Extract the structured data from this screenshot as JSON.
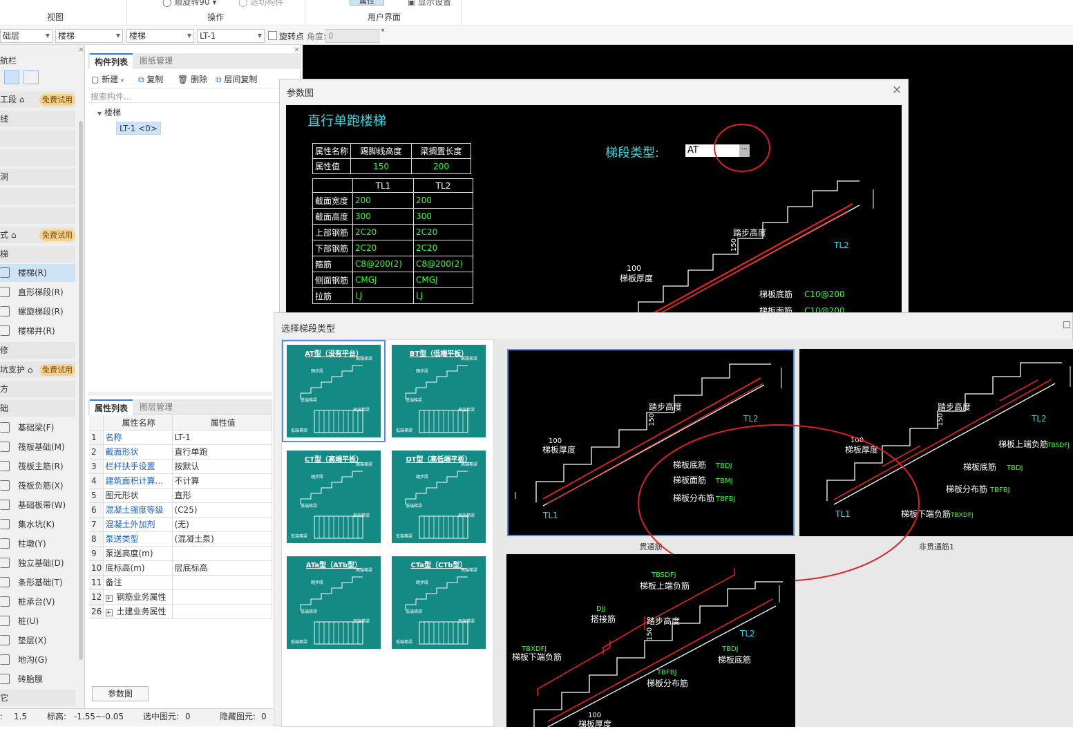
{
  "ribbon": {
    "groups": [
      "视图",
      "操作",
      "用户界面"
    ],
    "rotate_label": "顺旋转90",
    "assign_label": "选切构件",
    "property_btn": "属性",
    "display_label": "显示设置"
  },
  "toolbar": {
    "floor": "础层",
    "category": "楼梯",
    "type": "楼梯",
    "component": "LT-1",
    "rotate_point": "旋转点",
    "angle_label": "角度:",
    "angle_value": "0",
    "degree": "°"
  },
  "nav": {
    "title": "航栏",
    "rows": [
      {
        "label": "工段",
        "badge": "免费试用"
      },
      {
        "label": "线"
      },
      {
        "label": ""
      },
      {
        "label": ""
      },
      {
        "label": "洞"
      },
      {
        "label": ""
      },
      {
        "label": ""
      },
      {
        "label": "式",
        "badge": "免费试用"
      },
      {
        "label": "梯"
      }
    ],
    "stairs": [
      "楼梯(R)",
      "直形梯段(R)",
      "螺旋梯段(R)",
      "楼梯井(R)"
    ],
    "row_mid": "修",
    "support": {
      "label": "坑支护",
      "badge": "免费试用"
    },
    "row_b": "方",
    "row_c": "础",
    "foundation": [
      "基础梁(F)",
      "筏板基础(M)",
      "筏板主筋(R)",
      "筏板负筋(X)",
      "基础板带(W)",
      "集水坑(K)",
      "柱墩(Y)",
      "独立基础(D)",
      "条形基础(T)",
      "桩承台(V)",
      "桩(U)",
      "垫层(X)",
      "地沟(G)",
      "砖胎膜"
    ],
    "row_last": "它"
  },
  "component_list": {
    "tabs": [
      "构件列表",
      "图纸管理"
    ],
    "actions": [
      "新建",
      "复制",
      "删除",
      "层间复制"
    ],
    "search_placeholder": "搜索构件...",
    "tree_root": "楼梯",
    "tree_item": "LT-1 <0>"
  },
  "property_list": {
    "tabs": [
      "属性列表",
      "图层管理"
    ],
    "headers": [
      "属性名称",
      "属性值"
    ],
    "rows": [
      {
        "no": "1",
        "name": "名称",
        "value": "LT-1",
        "blue": true
      },
      {
        "no": "2",
        "name": "截面形状",
        "value": "直行单跑",
        "blue": true
      },
      {
        "no": "3",
        "name": "栏杆扶手设置",
        "value": "按默认",
        "blue": true
      },
      {
        "no": "4",
        "name": "建筑面积计算...",
        "value": "不计算",
        "blue": true
      },
      {
        "no": "5",
        "name": "图元形状",
        "value": "直形",
        "blue": false
      },
      {
        "no": "6",
        "name": "混凝土强度等级",
        "value": "(C25)",
        "blue": true
      },
      {
        "no": "7",
        "name": "混凝土外加剂",
        "value": "(无)",
        "blue": true
      },
      {
        "no": "8",
        "name": "泵送类型",
        "value": "(混凝土泵)",
        "blue": true
      },
      {
        "no": "9",
        "name": "泵送高度(m)",
        "value": "",
        "blue": false
      },
      {
        "no": "10",
        "name": "底标高(m)",
        "value": "层底标高",
        "blue": false
      },
      {
        "no": "11",
        "name": "备注",
        "value": "",
        "blue": false
      },
      {
        "no": "12",
        "name": "钢筋业务属性",
        "value": "",
        "blue": false,
        "expand": true
      },
      {
        "no": "26",
        "name": "土建业务属性",
        "value": "",
        "blue": false,
        "expand": true
      }
    ],
    "param_button": "参数图"
  },
  "status": {
    "scale": "1.5",
    "elev_label": "标高:",
    "elev_value": "-1.55~-0.05",
    "selected_label": "选中图元:",
    "selected_value": "0",
    "hidden_label": "隐藏图元:",
    "hidden_value": "0"
  },
  "param_dialog": {
    "title": "参数图",
    "heading": "直行单跑楼梯",
    "segment_label": "梯段类型:",
    "segment_value": "AT",
    "t1_headers": [
      "属性名称",
      "踢脚线高度",
      "梁搁置长度"
    ],
    "t1_row": [
      "属性值",
      "150",
      "200"
    ],
    "t2_headers": [
      "",
      "TL1",
      "TL2"
    ],
    "t2_rows": [
      [
        "截面宽度",
        "200",
        "200"
      ],
      [
        "截面高度",
        "300",
        "300"
      ],
      [
        "上部钢筋",
        "2C20",
        "2C20"
      ],
      [
        "下部钢筋",
        "2C20",
        "2C20"
      ],
      [
        "箍筋",
        "C8@200(2)",
        "C8@200(2)"
      ],
      [
        "侧面钢筋",
        "CMGJ",
        "CMGJ"
      ],
      [
        "拉筋",
        "LJ",
        "LJ"
      ]
    ],
    "drawing": {
      "step_height": "踏步高度",
      "v150": "150",
      "v100": "100",
      "slab_thk": "梯板厚度",
      "tl2": "TL2",
      "bottom_bar": "梯板底筋",
      "bottom_val": "C10@200",
      "face_bar": "梯板面筋",
      "face_val": "C10@200"
    }
  },
  "select_dialog": {
    "title": "选择梯段类型",
    "types": [
      "AT型（没有平台）",
      "BT型（低端平板）",
      "CT型（高端平板）",
      "DT型（高低端平板）",
      "ATa型（ATb型）",
      "CTa型（CTb型）"
    ],
    "thumb_labels": [
      "踏步段",
      "低端梯梁",
      "高端梯梁",
      "低端平板",
      "高端平板",
      "滑动支座"
    ],
    "captions": [
      "贯通筋",
      "非贯通筋1"
    ],
    "p1": {
      "step": "踏步高度",
      "v150": "150",
      "v100": "100",
      "thk": "梯板厚度",
      "tl1": "TL1",
      "tl2": "TL2",
      "b1": "梯板底筋",
      "b1v": "TBDJ",
      "b2": "梯板面筋",
      "b2v": "TBMJ",
      "b3": "梯板分布筋",
      "b3v": "TBFBJ"
    },
    "p2": {
      "step": "踏步高度",
      "v150": "150",
      "v100": "100",
      "thk": "梯板厚度",
      "tl1": "TL1",
      "tl2": "TL2",
      "up": "梯板上端负筋",
      "upv": "TBSDFJ",
      "b1": "梯板底筋",
      "b1v": "TBDJ",
      "b3": "梯板分布筋",
      "b3v": "TBFBJ",
      "low": "梯板下端负筋",
      "lowv": "TBXDFJ"
    },
    "p3": {
      "upv": "TBSDFJ",
      "up": "梯板上端负筋",
      "djv": "DJJ",
      "dj": "搭接筋",
      "step": "踏步高度",
      "v150": "150",
      "tl2": "TL2",
      "lowv": "TBXDFJ",
      "low": "梯板下端负筋",
      "b1v": "TBDJ",
      "b1": "梯板底筋",
      "b3v": "TBFBJ",
      "b3": "梯板分布筋",
      "v100": "100",
      "thk": "梯板厚度"
    }
  },
  "colors": {
    "accent": "#2f7bd6",
    "teal": "#148a85",
    "cad_red": "#ff2020",
    "cad_green": "#30ff30",
    "cad_cyan": "#30d8e0",
    "badge": "#f6d28a"
  }
}
